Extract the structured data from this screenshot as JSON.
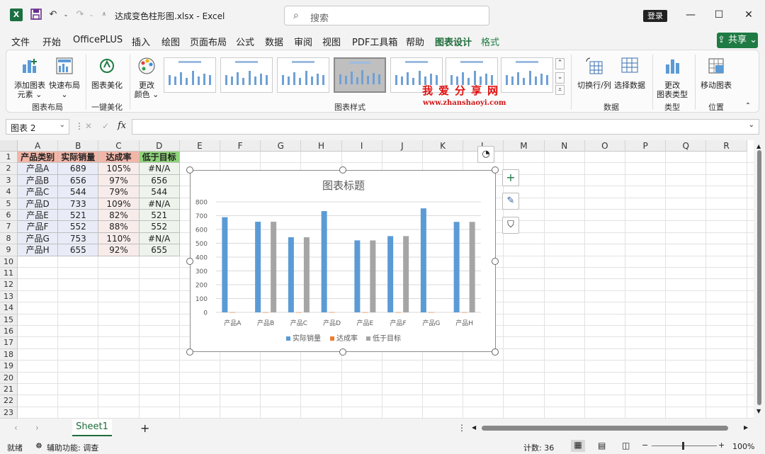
{
  "titlebar": {
    "doc_title": "达成变色柱形图.xlsx  -  Excel",
    "search_placeholder": "搜索",
    "login": "登录",
    "app_letter": "X"
  },
  "menu": {
    "tabs": [
      "文件",
      "开始",
      "OfficePLUS",
      "插入",
      "绘图",
      "页面布局",
      "公式",
      "数据",
      "审阅",
      "视图",
      "PDF工具箱",
      "帮助",
      "图表设计",
      "格式"
    ],
    "active": "图表设计",
    "share": "共享"
  },
  "ribbon": {
    "add_element_line1": "添加图表",
    "add_element_line2": "元素",
    "quick_layout": "快速布局",
    "group_layout": "图表布局",
    "beautify": "图表美化",
    "group_beautify": "一键美化",
    "change_color_line1": "更改",
    "change_color_line2": "颜色",
    "group_styles": "图表样式",
    "switch_rowcol": "切换行/列",
    "select_data": "选择数据",
    "group_data": "数据",
    "change_type_line1": "更改",
    "change_type_line2": "图表类型",
    "group_type": "类型",
    "move_chart": "移动图表",
    "group_location": "位置"
  },
  "watermark": {
    "cn": "我爱分享网",
    "url": "www.zhanshaoyi.com"
  },
  "formula_bar": {
    "name_box": "图表 2",
    "fx": "fx",
    "cancel": "✕",
    "confirm": "✓"
  },
  "sheet": {
    "columns": [
      "A",
      "B",
      "C",
      "D",
      "E",
      "F",
      "G",
      "H",
      "I",
      "J",
      "K",
      "L",
      "M",
      "N",
      "O",
      "P",
      "Q",
      "R"
    ],
    "rows": [
      "1",
      "2",
      "3",
      "4",
      "5",
      "6",
      "7",
      "8",
      "9",
      "10",
      "11",
      "12",
      "13",
      "14",
      "15",
      "16",
      "17",
      "18",
      "19",
      "20",
      "21",
      "22",
      "23"
    ],
    "header": [
      "产品类别",
      "实际销量",
      "达成率",
      "低于目标"
    ],
    "data": [
      [
        "产品A",
        "689",
        "105%",
        "#N/A"
      ],
      [
        "产品B",
        "656",
        "97%",
        "656"
      ],
      [
        "产品C",
        "544",
        "79%",
        "544"
      ],
      [
        "产品D",
        "733",
        "109%",
        "#N/A"
      ],
      [
        "产品E",
        "521",
        "82%",
        "521"
      ],
      [
        "产品F",
        "552",
        "88%",
        "552"
      ],
      [
        "产品G",
        "753",
        "110%",
        "#N/A"
      ],
      [
        "产品H",
        "655",
        "92%",
        "655"
      ]
    ],
    "header_colors": [
      "#f2b6a8",
      "#f2b6a8",
      "#f2b6a8",
      "#8fd27a"
    ]
  },
  "chart_data": {
    "type": "bar",
    "title": "图表标题",
    "categories": [
      "产品A",
      "产品B",
      "产品C",
      "产品D",
      "产品E",
      "产品F",
      "产品G",
      "产品H"
    ],
    "series": [
      {
        "name": "实际销量",
        "color": "#5b9bd5",
        "values": [
          689,
          656,
          544,
          733,
          521,
          552,
          753,
          655
        ]
      },
      {
        "name": "达成率",
        "color": "#ed7d31",
        "values": [
          1.05,
          0.97,
          0.79,
          1.09,
          0.82,
          0.88,
          1.1,
          0.92
        ]
      },
      {
        "name": "低于目标",
        "color": "#a5a5a5",
        "values": [
          null,
          656,
          544,
          null,
          521,
          552,
          null,
          655
        ]
      }
    ],
    "ylim": [
      0,
      800
    ],
    "yticks": [
      "800",
      "700",
      "600",
      "500",
      "400",
      "300",
      "200",
      "100",
      "0"
    ],
    "grid": true,
    "legend": "bottom"
  },
  "tabs_bottom": {
    "sheet": "Sheet1",
    "add": "+"
  },
  "status": {
    "ready": "就绪",
    "accessibility": "辅助功能: 调查",
    "count": "计数: 36",
    "zoom": "100%"
  }
}
